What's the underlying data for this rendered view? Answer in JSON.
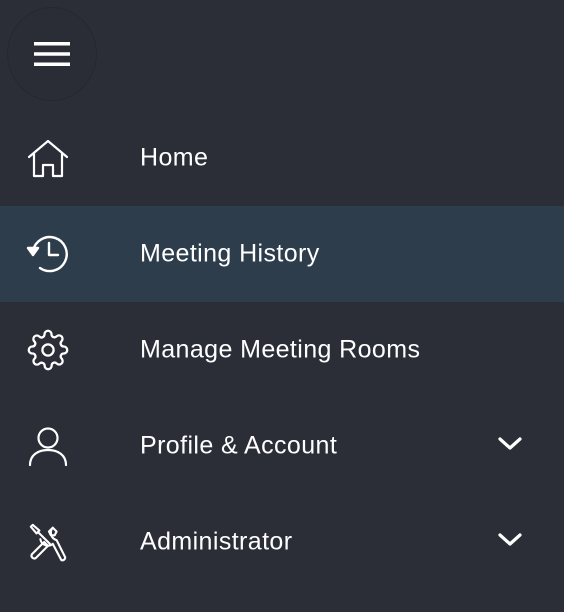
{
  "menu_button": {
    "icon": "hamburger-menu-icon"
  },
  "nav": {
    "items": [
      {
        "id": "home",
        "label": "Home",
        "icon": "home-icon",
        "active": false,
        "expandable": false
      },
      {
        "id": "meeting-history",
        "label": "Meeting History",
        "icon": "history-clock-icon",
        "active": true,
        "expandable": false
      },
      {
        "id": "manage-meeting-rooms",
        "label": "Manage Meeting Rooms",
        "icon": "gear-icon",
        "active": false,
        "expandable": false
      },
      {
        "id": "profile-account",
        "label": "Profile & Account",
        "icon": "user-icon",
        "active": false,
        "expandable": true
      },
      {
        "id": "administrator",
        "label": "Administrator",
        "icon": "tools-icon",
        "active": false,
        "expandable": true
      }
    ]
  },
  "colors": {
    "background": "#2b2e37",
    "active_row": "#2d3d4c",
    "text": "#ffffff"
  }
}
